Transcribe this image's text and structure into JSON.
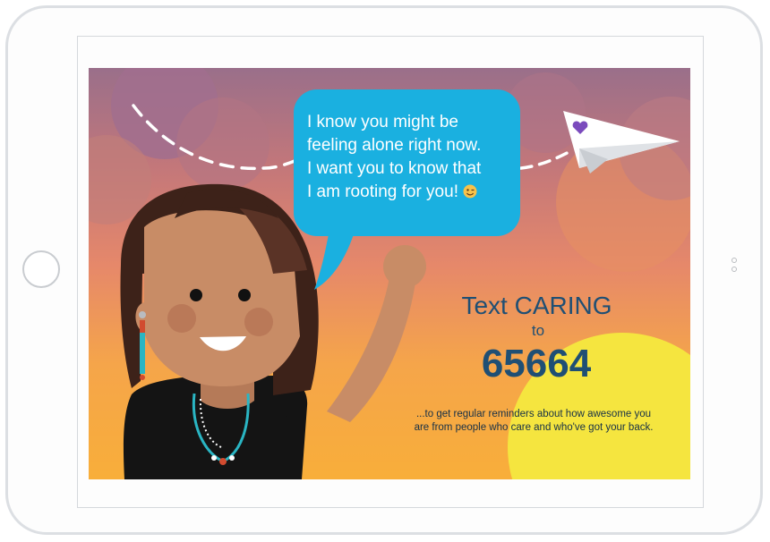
{
  "message": {
    "lines": [
      "I know you might be",
      "feeling alone right now.",
      "I want you to know that",
      "I am rooting for you!"
    ],
    "emoji": "smiling-face-emoji-icon"
  },
  "cta": {
    "title": "Text CARING",
    "to": "to",
    "number": "65664",
    "body_lines": [
      "...to get regular reminders about how awesome you",
      "are from people who care and who've got your back."
    ]
  },
  "colors": {
    "bubble": "#1ab0e0",
    "cta_text": "#1f4f74",
    "sun": "#f5e53f",
    "skin": "#c88c66",
    "hair": "#3d2219"
  },
  "icons": [
    "paper-plane-icon",
    "heart-icon",
    "smiling-face-emoji-icon",
    "home-button-icon"
  ]
}
